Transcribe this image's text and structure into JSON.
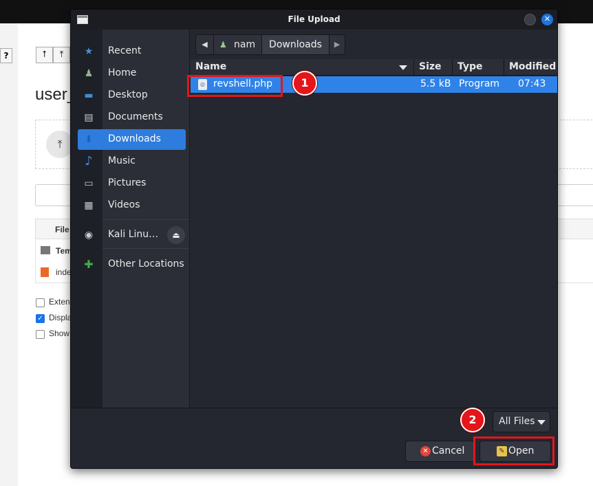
{
  "background_page": {
    "help_button": "?",
    "title_fragment": "user_",
    "table_header_fragment": "File",
    "rows": [
      "Tem",
      "inde"
    ],
    "options": [
      {
        "label": "Exten",
        "checked": false
      },
      {
        "label": "Displa",
        "checked": true
      },
      {
        "label": "Show",
        "checked": false
      }
    ]
  },
  "dialog": {
    "title": "File Upload",
    "close_glyph": "✕",
    "sidebar": {
      "items": [
        {
          "label": "Recent",
          "icon": "star-icon",
          "glyph": "★",
          "selected": false
        },
        {
          "label": "Home",
          "icon": "home-user-icon",
          "glyph": "♟",
          "selected": false
        },
        {
          "label": "Desktop",
          "icon": "desktop-icon",
          "glyph": "▬",
          "selected": false
        },
        {
          "label": "Documents",
          "icon": "document-icon",
          "glyph": "▤",
          "selected": false
        },
        {
          "label": "Downloads",
          "icon": "download-icon",
          "glyph": "⬇",
          "selected": true
        },
        {
          "label": "Music",
          "icon": "music-icon",
          "glyph": "♪",
          "selected": false
        },
        {
          "label": "Pictures",
          "icon": "picture-icon",
          "glyph": "▭",
          "selected": false
        },
        {
          "label": "Videos",
          "icon": "video-icon",
          "glyph": "▦",
          "selected": false
        }
      ],
      "drive": {
        "label": "Kali Linu…",
        "icon": "disc-icon",
        "glyph": "◉",
        "eject_glyph": "⏏"
      },
      "other": {
        "label": "Other Locations",
        "icon": "plus-icon",
        "glyph": "✚"
      }
    },
    "pathbar": {
      "back_glyph": "◀",
      "forward_glyph": "▶",
      "home_glyph": "♟",
      "home_label": "nam",
      "current": "Downloads"
    },
    "columns": {
      "name": "Name",
      "size": "Size",
      "type": "Type",
      "modified": "Modified"
    },
    "files": [
      {
        "icon": "php-file-icon",
        "glyph": "◎",
        "name": "revshell.php",
        "size": "5.5 kB",
        "type": "Program",
        "modified": "07:43",
        "selected": true
      }
    ],
    "filter": "All Files",
    "cancel_label": "Cancel",
    "cancel_glyph": "✕",
    "open_label": "Open",
    "open_glyph": "✎"
  },
  "annotations": {
    "step1": "1",
    "step2": "2"
  },
  "colors": {
    "accent": "#2f83e8",
    "annotation": "#e4161b",
    "dialog_bg": "#24272f"
  }
}
